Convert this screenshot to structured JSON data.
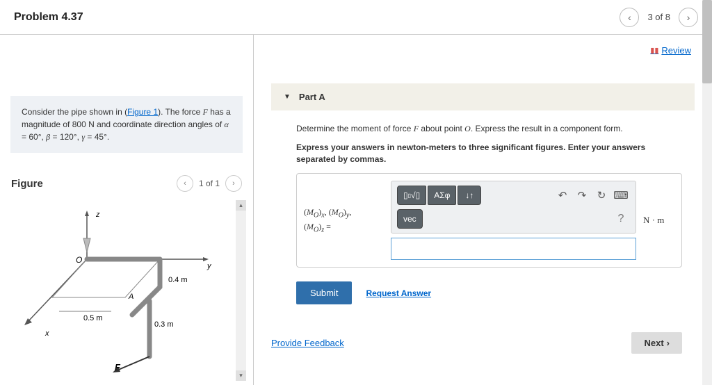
{
  "header": {
    "title": "Problem 4.37",
    "nav_label": "3 of 8"
  },
  "problem": {
    "text_before_link": "Consider the pipe shown in (",
    "figure_link": "Figure 1",
    "text_after_link": "). The force ",
    "force_var": "F",
    "text_mag": " has a magnitude of 800 ",
    "unit_N": "N",
    "text_angles": " and coordinate direction angles of ",
    "alpha": "α",
    "alpha_val": " = 60°, ",
    "beta": "β",
    "beta_val": " = 120°, ",
    "gamma": "γ",
    "gamma_val": " = 45°."
  },
  "figure": {
    "title": "Figure",
    "nav_label": "1 of 1",
    "labels": {
      "z": "z",
      "y": "y",
      "x": "x",
      "O": "O",
      "A": "A",
      "F": "F",
      "d1": "0.4 m",
      "d2": "0.5 m",
      "d3": "0.3 m"
    }
  },
  "review": {
    "label": " Review"
  },
  "partA": {
    "title": "Part A",
    "question_before": "Determine the moment of force ",
    "question_F": "F",
    "question_mid": " about point ",
    "question_O": "O",
    "question_after": ". Express the result in a component form.",
    "instruction": "Express your answers in newton-meters to three significant figures. Enter your answers separated by commas.",
    "mo_line1": "(M_O)_x, (M_O)_y,",
    "mo_line2": "(M_O)_z =",
    "unit": "N · m",
    "submit": "Submit",
    "request": "Request Answer",
    "tools": {
      "sqrt": "∜□",
      "greek": "ΑΣφ",
      "arrows": "↓↑",
      "vec": "vec",
      "help": "?"
    }
  },
  "bottom": {
    "feedback": "Provide Feedback",
    "next": "Next"
  }
}
